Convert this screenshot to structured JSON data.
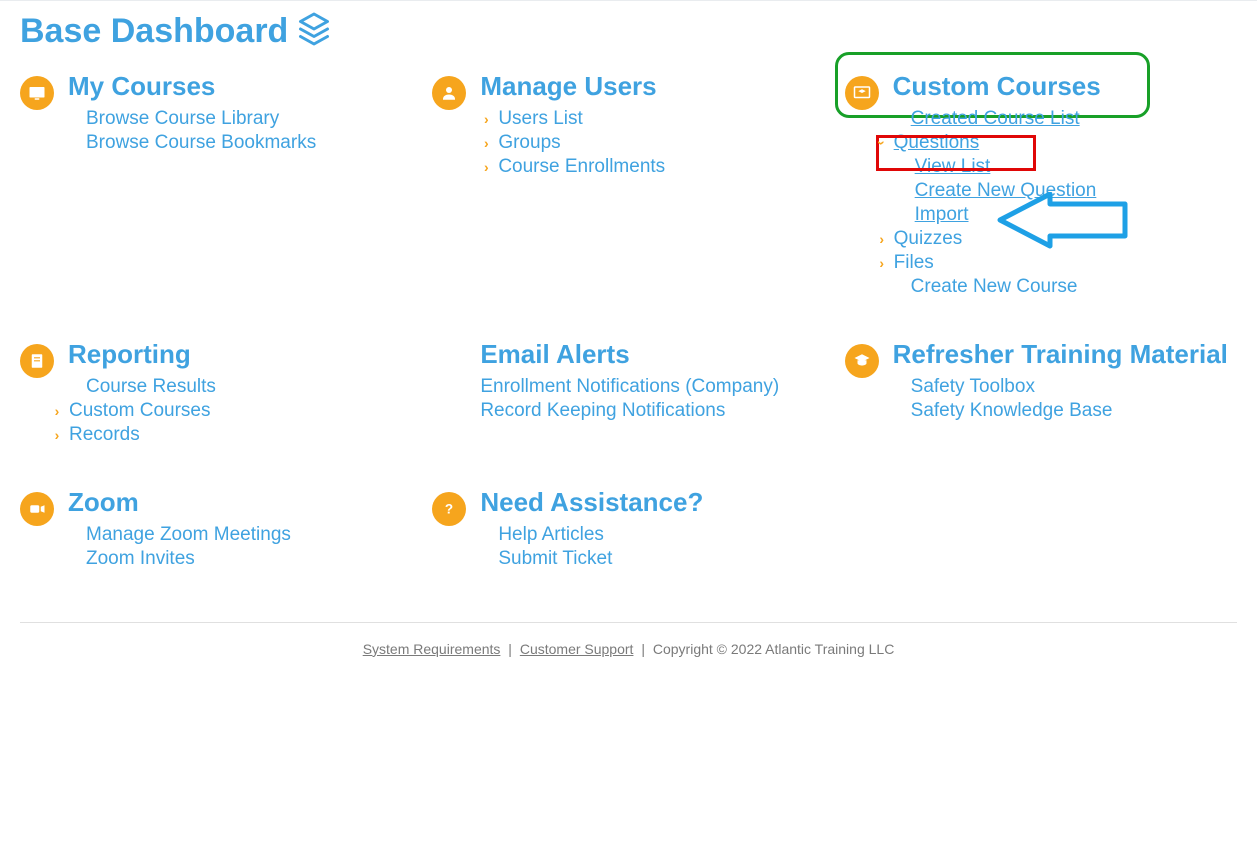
{
  "title": "Base Dashboard",
  "sections": {
    "my_courses": {
      "title": "My Courses",
      "links": {
        "browse_library": "Browse Course Library",
        "browse_bookmarks": "Browse Course Bookmarks"
      }
    },
    "manage_users": {
      "title": "Manage Users",
      "links": {
        "users_list": "Users List",
        "groups": "Groups",
        "enrollments": "Course Enrollments"
      }
    },
    "custom_courses": {
      "title": "Custom Courses",
      "links": {
        "created_list": "Created Course List",
        "questions": "Questions",
        "view_list": "View List",
        "create_question": "Create New Question",
        "import": "Import",
        "quizzes": "Quizzes",
        "files": "Files",
        "create_course": "Create New Course"
      }
    },
    "reporting": {
      "title": "Reporting",
      "links": {
        "course_results": "Course Results",
        "custom_courses": "Custom Courses",
        "records": "Records"
      }
    },
    "email_alerts": {
      "title": "Email Alerts",
      "links": {
        "enroll_notif": "Enrollment Notifications (Company)",
        "record_notif": "Record Keeping Notifications"
      }
    },
    "refresher": {
      "title": "Refresher Training Material",
      "links": {
        "toolbox": "Safety Toolbox",
        "knowledge": "Safety Knowledge Base"
      }
    },
    "zoom": {
      "title": "Zoom",
      "links": {
        "manage_meetings": "Manage Zoom Meetings",
        "invites": "Zoom Invites"
      }
    },
    "need_assistance": {
      "title": "Need Assistance?",
      "links": {
        "help_articles": "Help Articles",
        "submit_ticket": "Submit Ticket"
      }
    }
  },
  "footer": {
    "system_req": "System Requirements",
    "customer_support": "Customer Support",
    "copyright": "Copyright © 2022 Atlantic Training LLC"
  }
}
